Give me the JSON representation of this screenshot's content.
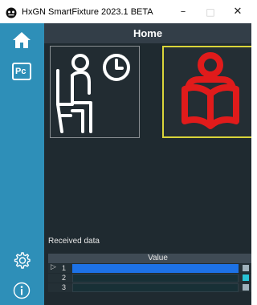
{
  "window": {
    "title": "HxGN SmartFixture 2023.1 BETA",
    "minimize_glyph": "–",
    "maximize_glyph": "□",
    "close_glyph": "✕"
  },
  "sidebar": {
    "items": [
      {
        "name": "home",
        "icon": "home-icon"
      },
      {
        "name": "pc",
        "icon": "pc-icon",
        "label": "Pc"
      }
    ],
    "bottom": [
      {
        "name": "settings",
        "icon": "gear-icon"
      },
      {
        "name": "info",
        "icon": "info-icon"
      }
    ]
  },
  "header": {
    "title": "Home"
  },
  "tiles": [
    {
      "icon": "waiting-person-icon",
      "selected": false
    },
    {
      "icon": "reading-person-icon",
      "selected": true
    }
  ],
  "received": {
    "label": "Received data",
    "column": "Value",
    "rows": [
      {
        "index": "1",
        "selected": true,
        "checked": false
      },
      {
        "index": "2",
        "selected": false,
        "checked": true
      },
      {
        "index": "3",
        "selected": false,
        "checked": false
      }
    ],
    "row_marker": "▷"
  },
  "colors": {
    "sidebar": "#2e8fb8",
    "header": "#333e48",
    "background": "#1f2a30",
    "accent_red": "#e01b1b",
    "tile_border_selected": "#d9d43a",
    "row_selected": "#1d72e6"
  }
}
